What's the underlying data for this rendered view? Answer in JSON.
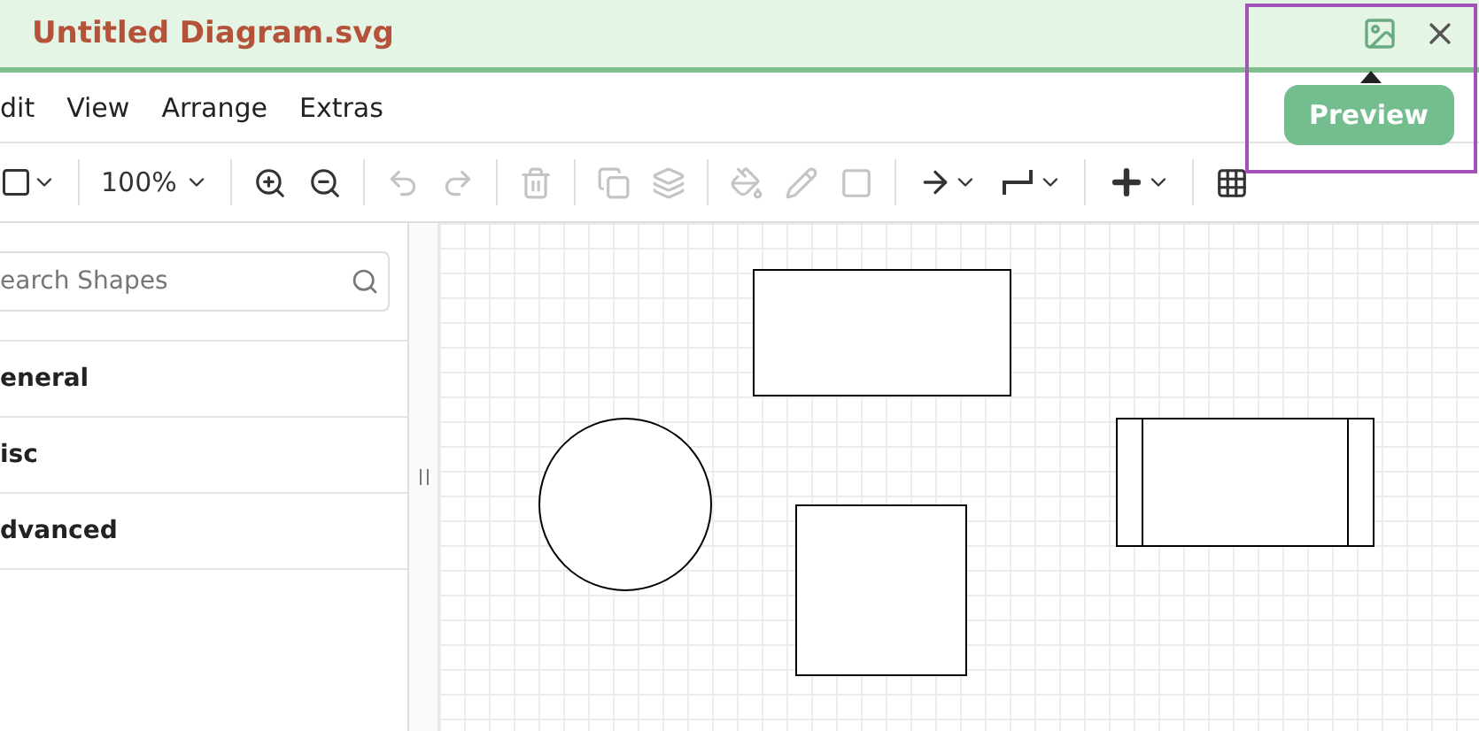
{
  "tab": {
    "title": "Untitled Diagram.svg"
  },
  "tab_actions": {
    "tooltip": "Preview"
  },
  "menu": [
    "dit",
    "View",
    "Arrange",
    "Extras"
  ],
  "toolbar": [
    {
      "kind": "format",
      "disabled": false
    },
    {
      "kind": "separator"
    },
    {
      "kind": "zoom",
      "label": "100%",
      "disabled": false
    },
    {
      "kind": "separator"
    },
    {
      "kind": "zoom-in",
      "disabled": false
    },
    {
      "kind": "zoom-out",
      "disabled": false
    },
    {
      "kind": "separator"
    },
    {
      "kind": "undo",
      "disabled": true
    },
    {
      "kind": "redo",
      "disabled": true
    },
    {
      "kind": "separator"
    },
    {
      "kind": "delete",
      "disabled": true
    },
    {
      "kind": "separator"
    },
    {
      "kind": "to-front",
      "disabled": true
    },
    {
      "kind": "to-back",
      "disabled": true
    },
    {
      "kind": "separator"
    },
    {
      "kind": "fill",
      "disabled": true
    },
    {
      "kind": "line",
      "disabled": true
    },
    {
      "kind": "shadow",
      "disabled": true
    },
    {
      "kind": "separator"
    },
    {
      "kind": "connection",
      "disabled": false
    },
    {
      "kind": "waypoint",
      "disabled": false
    },
    {
      "kind": "separator"
    },
    {
      "kind": "insert",
      "disabled": false
    },
    {
      "kind": "separator"
    },
    {
      "kind": "table",
      "disabled": false
    }
  ],
  "sidebar": {
    "search": {
      "placeholder": "earch Shapes"
    },
    "sections": [
      "eneral",
      "isc",
      "dvanced"
    ]
  },
  "shapes": [
    {
      "kind": "rect"
    },
    {
      "kind": "ellipse"
    },
    {
      "kind": "rect"
    },
    {
      "kind": "process"
    }
  ]
}
